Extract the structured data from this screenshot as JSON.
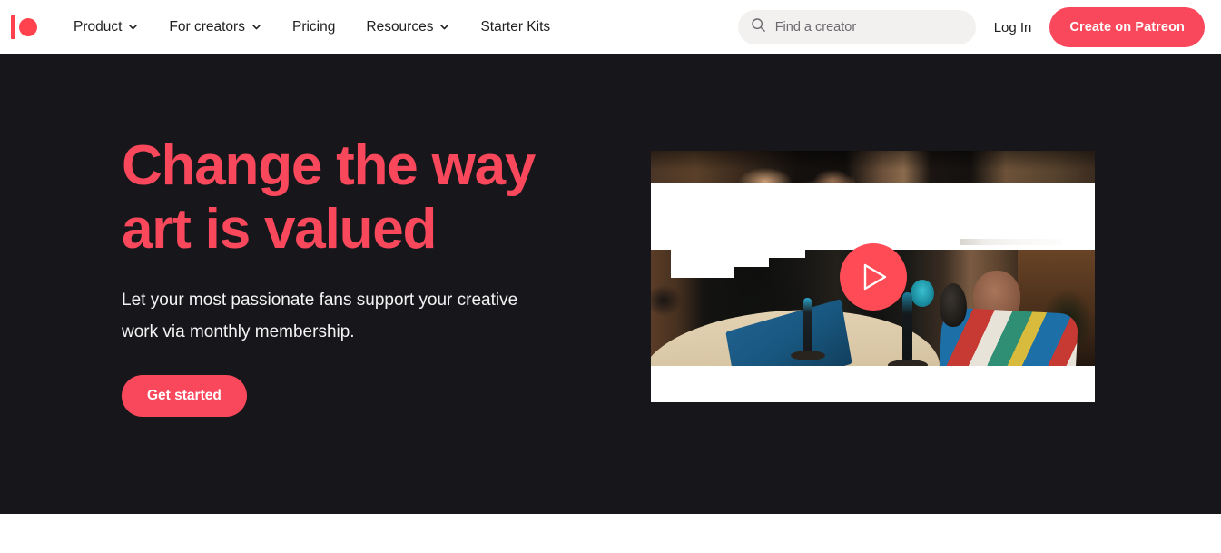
{
  "brand": {
    "name": "Patreon",
    "logo_icon": "patreon-logo-icon",
    "accent_color": "#FF424D",
    "cta_color": "#F9485B",
    "hero_bg_color": "#17171B",
    "nav_bg_color": "#FFFFFF"
  },
  "nav": {
    "items": [
      {
        "label": "Product",
        "has_dropdown": true,
        "icon": "chevron-down-icon"
      },
      {
        "label": "For creators",
        "has_dropdown": true,
        "icon": "chevron-down-icon"
      },
      {
        "label": "Pricing",
        "has_dropdown": false
      },
      {
        "label": "Resources",
        "has_dropdown": true,
        "icon": "chevron-down-icon"
      },
      {
        "label": "Starter Kits",
        "has_dropdown": false
      }
    ],
    "search": {
      "placeholder": "Find a creator",
      "value": "",
      "icon": "search-icon"
    },
    "login_label": "Log In",
    "create_label": "Create on Patreon"
  },
  "hero": {
    "title_line_1": "Change the way",
    "title_line_2": "art is valued",
    "subtitle": "Let your most passionate fans support your creative work via monthly membership.",
    "cta_label": "Get started",
    "video": {
      "play_icon": "play-triangle-icon",
      "alt": "Podcast creators recording at a table with microphones"
    }
  }
}
